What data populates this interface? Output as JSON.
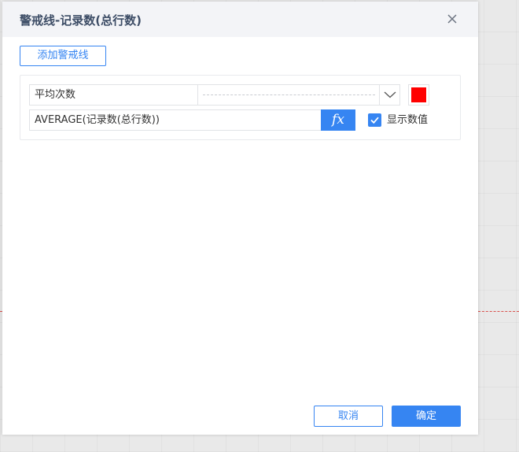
{
  "dialog": {
    "title": "警戒线-记录数(总行数)",
    "close_icon": "close-icon"
  },
  "toolbar": {
    "add_label": "添加警戒线"
  },
  "warning_line": {
    "name_value": "平均次数",
    "line_style": "dashed",
    "color": "#ff0000",
    "formula_value": "AVERAGE(记录数(总行数))",
    "fx_label": "fx",
    "show_value_checked": true,
    "show_value_label": "显示数值"
  },
  "footer": {
    "cancel_label": "取消",
    "ok_label": "确定"
  },
  "colors": {
    "accent": "#3685f2",
    "header_bg": "#f3f4f7",
    "title_text": "#3d4d66",
    "background_dash": "#d9534f"
  }
}
